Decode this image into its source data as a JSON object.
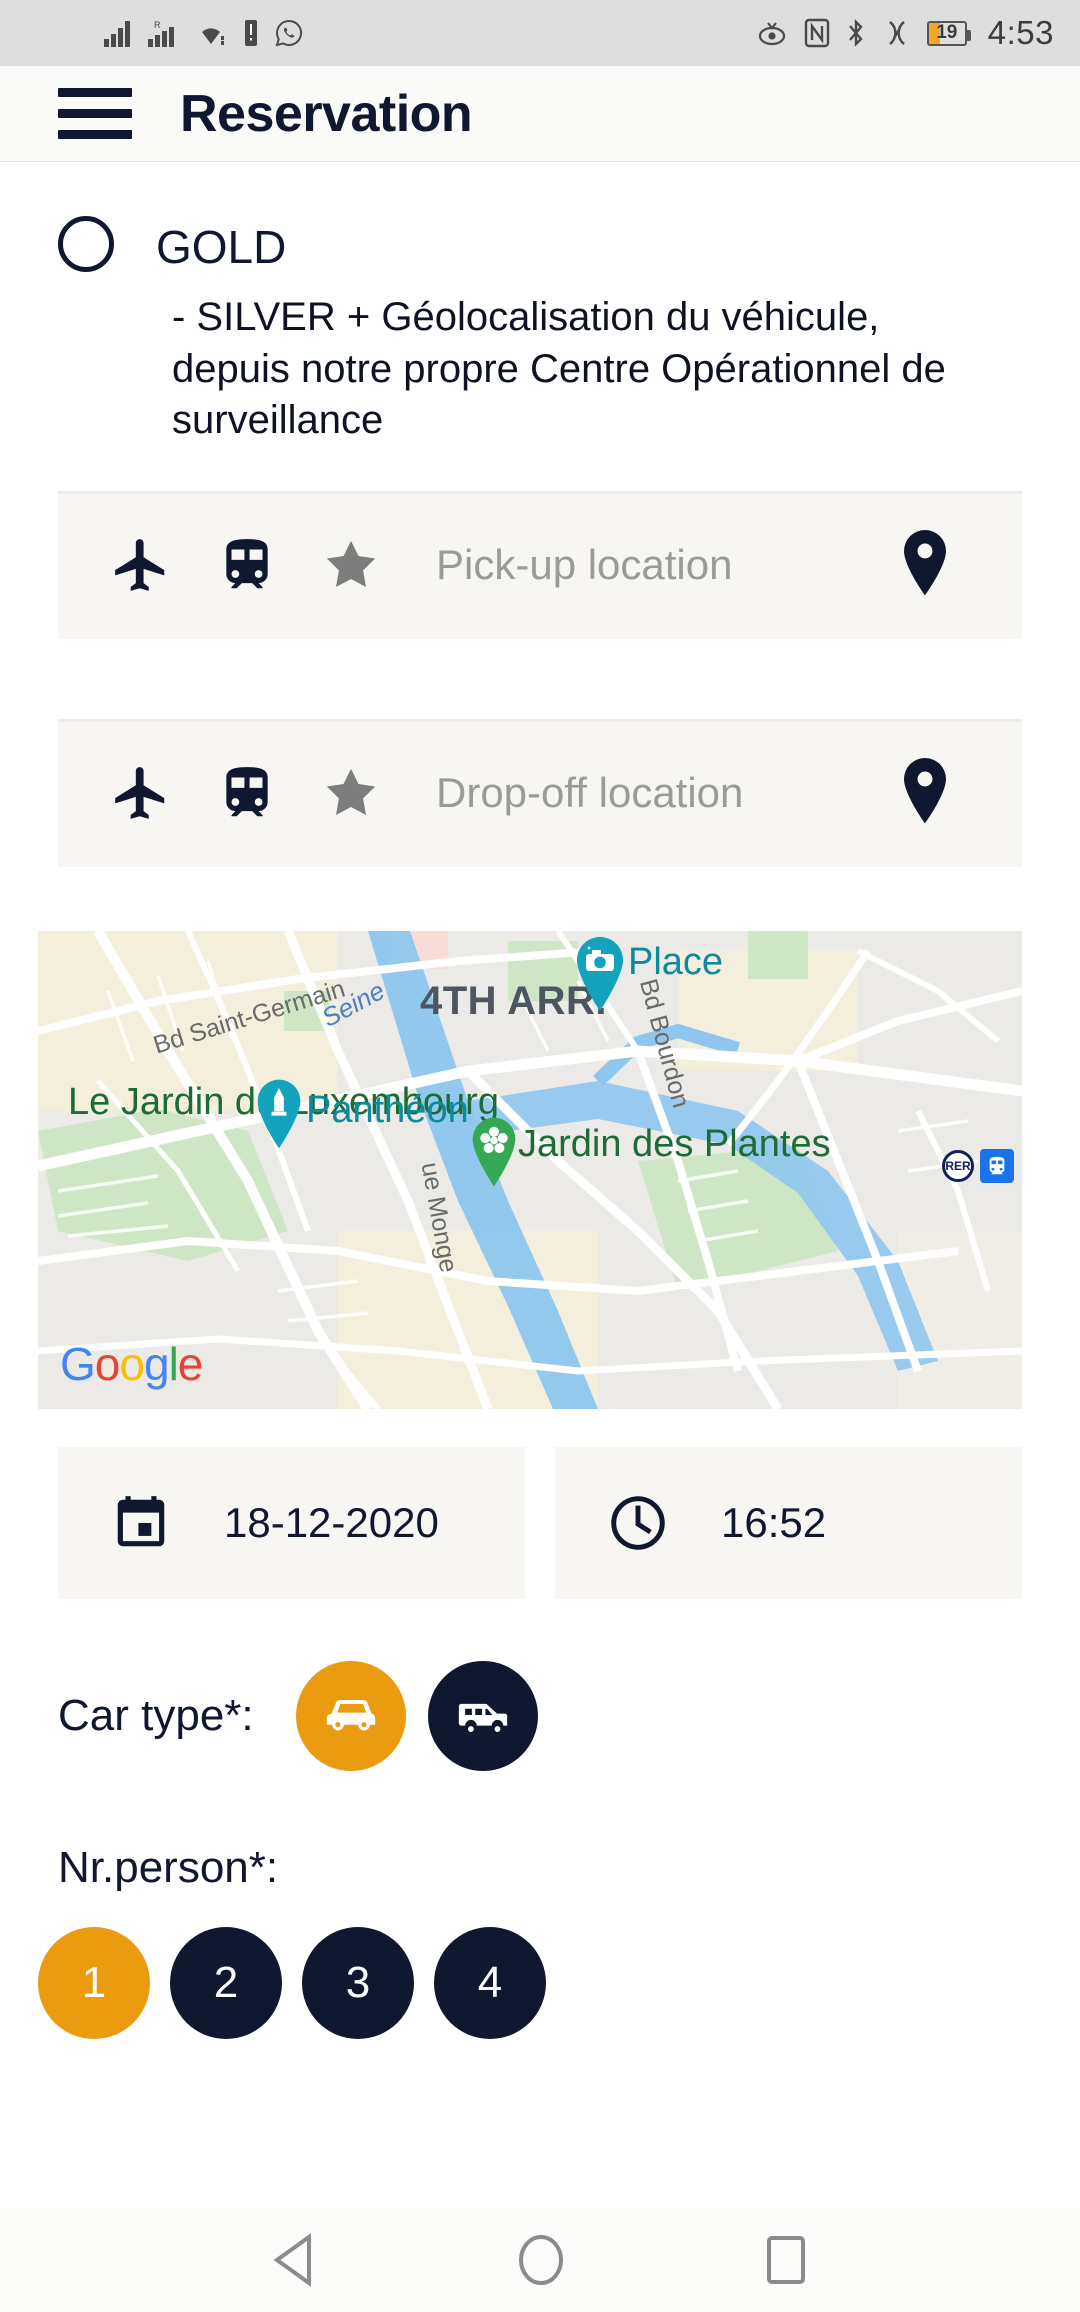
{
  "status_bar": {
    "time": "4:53",
    "battery_percent": "19",
    "icons": [
      "signal-bars-icon",
      "signal-bars-roaming-icon",
      "wifi-icon",
      "vibrate-icon",
      "whatsapp-icon",
      "eye-care-icon",
      "nfc-icon",
      "bluetooth-icon",
      "data-saver-icon",
      "battery-icon"
    ]
  },
  "app_bar": {
    "menu_icon": "hamburger-menu-icon",
    "title": "Reservation"
  },
  "plan": {
    "name": "GOLD",
    "selected": false,
    "description": "- SILVER + Géolocalisation du véhicule, depuis notre propre Centre Opérationnel de surveillance"
  },
  "pickup": {
    "placeholder": "Pick-up location",
    "value": "",
    "icons": [
      "airplane-icon",
      "train-icon",
      "star-icon"
    ],
    "pin_icon": "map-pin-icon"
  },
  "dropoff": {
    "placeholder": "Drop-off location",
    "value": "",
    "icons": [
      "airplane-icon",
      "train-icon",
      "star-icon"
    ],
    "pin_icon": "map-pin-icon"
  },
  "map": {
    "attribution": "Google",
    "labels": {
      "arrondissement": "4TH ARR.",
      "river": "Seine",
      "street_saint_germain": "Bd Saint-Germain",
      "street_bourdon": "Bd Bourdon",
      "street_monge": "ue Monge",
      "park_luxembourg": "Le Jardin du Luxembourg",
      "poi_pantheon": "Panthéon",
      "poi_place": "Place",
      "park_plantes": "Jardin des Plantes"
    },
    "markers": [
      {
        "name": "camera-marker",
        "label": "Place",
        "color": "#13a3bd"
      },
      {
        "name": "monument-marker",
        "label": "Panthéon",
        "color": "#13a3bd"
      },
      {
        "name": "park-marker",
        "label": "Jardin des Plantes",
        "color": "#34a853"
      }
    ],
    "transit_icons": [
      "rer-icon",
      "train-station-icon"
    ]
  },
  "date_field": {
    "icon": "calendar-icon",
    "value": "18-12-2020"
  },
  "time_field": {
    "icon": "clock-icon",
    "value": "16:52"
  },
  "car_type": {
    "label": "Car type*:",
    "options": [
      {
        "name": "sedan-icon",
        "selected": true
      },
      {
        "name": "van-icon",
        "selected": false
      }
    ]
  },
  "nr_person": {
    "label": "Nr.person*:",
    "options": [
      "1",
      "2",
      "3",
      "4"
    ],
    "selected": "1"
  },
  "nav_bar": {
    "back": "back-triangle-icon",
    "home": "home-circle-icon",
    "recents": "recents-square-icon"
  },
  "colors": {
    "accent_orange": "#eb9b10",
    "dark_navy": "#101830",
    "field_bg": "#f7f6f3",
    "placeholder": "#9b9b96"
  }
}
